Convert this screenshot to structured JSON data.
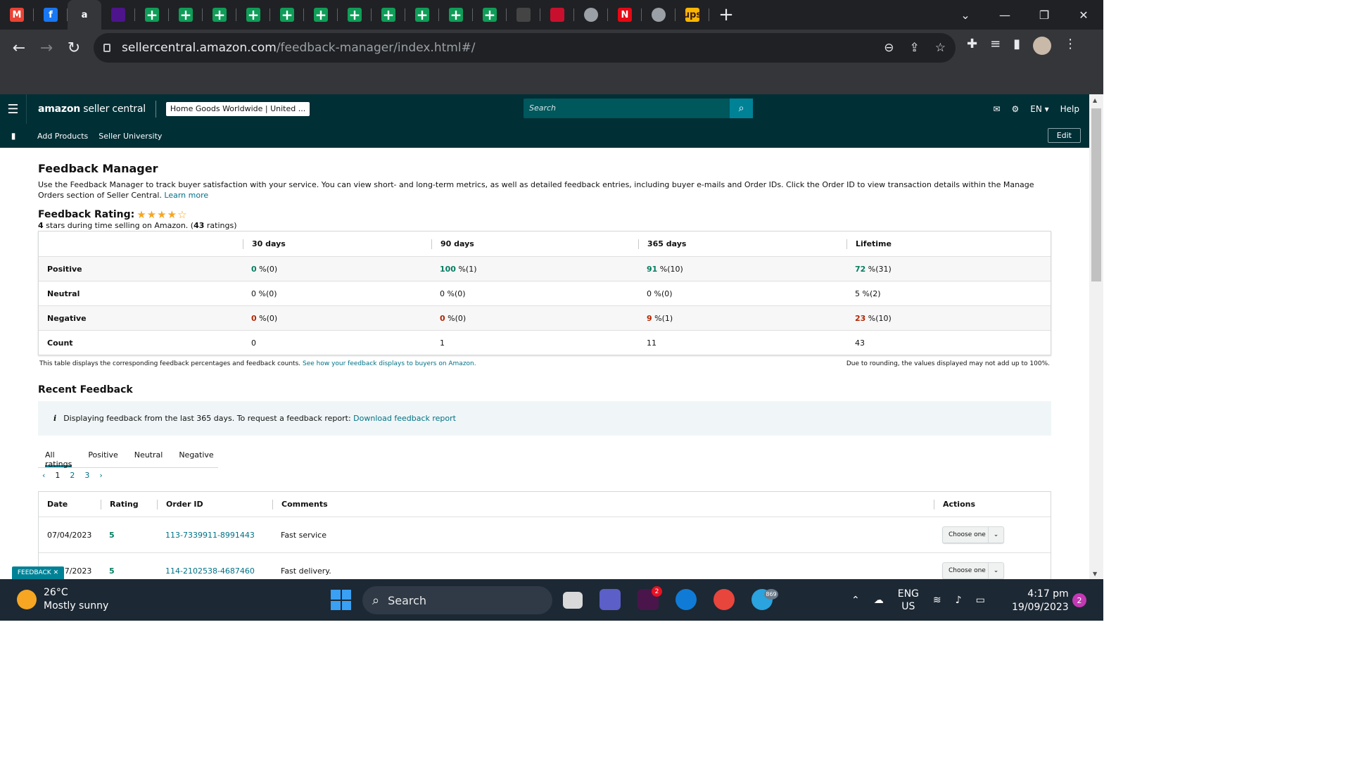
{
  "browser": {
    "tabs": [
      {
        "icon": "gmail-icon",
        "label": "M",
        "color": "#ea4335"
      },
      {
        "icon": "facebook-icon",
        "label": "f",
        "color": "#1877f2"
      },
      {
        "icon": "amazon-icon",
        "label": "a",
        "color": "#ffffff",
        "active": true
      },
      {
        "icon": "fedex-icon",
        "label": "",
        "color": "#4d148c"
      },
      {
        "icon": "sheets-icon"
      },
      {
        "icon": "sheets-icon"
      },
      {
        "icon": "sheets-icon"
      },
      {
        "icon": "sheets-icon"
      },
      {
        "icon": "sheets-icon"
      },
      {
        "icon": "sheets-icon"
      },
      {
        "icon": "sheets-icon"
      },
      {
        "icon": "sheets-icon"
      },
      {
        "icon": "sheets-icon"
      },
      {
        "icon": "sheets-icon"
      },
      {
        "icon": "sheets-icon"
      },
      {
        "icon": "chart-site-icon",
        "label": "",
        "color": "#444"
      },
      {
        "icon": "red-site-icon",
        "label": "",
        "color": "#c8102e"
      },
      {
        "icon": "globe-icon",
        "label": "",
        "color": "#9aa0a6"
      },
      {
        "icon": "netflix-icon",
        "label": "N",
        "color": "#e50914"
      },
      {
        "icon": "globe-icon",
        "label": "",
        "color": "#9aa0a6"
      },
      {
        "icon": "ups-icon",
        "label": "ups",
        "color": "#ffb500"
      }
    ],
    "url_host": "sellercentral.amazon.com",
    "url_path": "/feedback-manager/index.html#/"
  },
  "seller_central": {
    "logo_bold": "amazon",
    "logo_rest": " seller central",
    "store": "Home Goods Worldwide | United ...",
    "search_placeholder": "Search",
    "lang": "EN ▾",
    "help": "Help",
    "sub_links": [
      "Add Products",
      "Seller University"
    ],
    "edit": "Edit"
  },
  "page": {
    "title": "Feedback Manager",
    "description": "Use the Feedback Manager to track buyer satisfaction with your service. You can view short- and long-term metrics, as well as detailed feedback entries, including buyer e-mails and Order IDs. Click the Order ID to view transaction details within the Manage Orders section of Seller Central.",
    "learn_more": "Learn more",
    "rating_label": "Feedback Rating:",
    "rating_stars": 4,
    "rating_max": 5,
    "rating_sub_stars": "4",
    "rating_sub_mid": " stars during time selling on Amazon. (",
    "rating_sub_count": "43",
    "rating_sub_end": " ratings)"
  },
  "metrics": {
    "headers": [
      "",
      "30 days",
      "90 days",
      "365 days",
      "Lifetime"
    ],
    "rows": [
      {
        "label": "Positive",
        "cells": [
          {
            "v": "0",
            "s": " %(0)",
            "c": "g"
          },
          {
            "v": "100",
            "s": " %(1)",
            "c": "g"
          },
          {
            "v": "91",
            "s": " %(10)",
            "c": "g"
          },
          {
            "v": "72",
            "s": " %(31)",
            "c": "g"
          }
        ]
      },
      {
        "label": "Neutral",
        "cells": [
          {
            "v": "0",
            "s": " %(0)",
            "c": ""
          },
          {
            "v": "0",
            "s": " %(0)",
            "c": ""
          },
          {
            "v": "0",
            "s": " %(0)",
            "c": ""
          },
          {
            "v": "5",
            "s": " %(2)",
            "c": ""
          }
        ]
      },
      {
        "label": "Negative",
        "cells": [
          {
            "v": "0",
            "s": " %(0)",
            "c": "r"
          },
          {
            "v": "0",
            "s": " %(0)",
            "c": "r"
          },
          {
            "v": "9",
            "s": " %(1)",
            "c": "r"
          },
          {
            "v": "23",
            "s": " %(10)",
            "c": "r"
          }
        ]
      },
      {
        "label": "Count",
        "cells": [
          {
            "v": "0",
            "s": "",
            "c": ""
          },
          {
            "v": "1",
            "s": "",
            "c": ""
          },
          {
            "v": "11",
            "s": "",
            "c": ""
          },
          {
            "v": "43",
            "s": "",
            "c": ""
          }
        ]
      }
    ],
    "footer_left": "This table displays the corresponding feedback percentages and feedback counts.",
    "footer_link": "See how your feedback displays to buyers on Amazon.",
    "footer_right": "Due to rounding, the values displayed may not add up to 100%."
  },
  "recent": {
    "title": "Recent Feedback",
    "info_text": "Displaying feedback from the last 365 days. To request a feedback report:",
    "info_link": "Download feedback report",
    "tabs": [
      "All ratings",
      "Positive",
      "Neutral",
      "Negative"
    ],
    "pages": [
      "1",
      "2",
      "3"
    ],
    "headers": [
      "Date",
      "Rating",
      "Order ID",
      "Comments",
      "Actions"
    ],
    "rows": [
      {
        "date": "07/04/2023",
        "rating": "5",
        "order": "113-7339911-8991443",
        "comment": "Fast service",
        "action": "Choose one"
      },
      {
        "date": "04/07/2023",
        "rating": "5",
        "order": "114-2102538-4687460",
        "comment": "Fast delivery.",
        "action": "Choose one"
      }
    ],
    "feedback_tab": "FEEDBACK ✕"
  },
  "taskbar": {
    "temp": "26°C",
    "condition": "Mostly sunny",
    "search": "Search",
    "slack_badge": "2",
    "telegram_badge": "869",
    "lang_top": "ENG",
    "lang_bottom": "US",
    "time": "4:17 pm",
    "date": "19/09/2023",
    "notifications": "2"
  }
}
